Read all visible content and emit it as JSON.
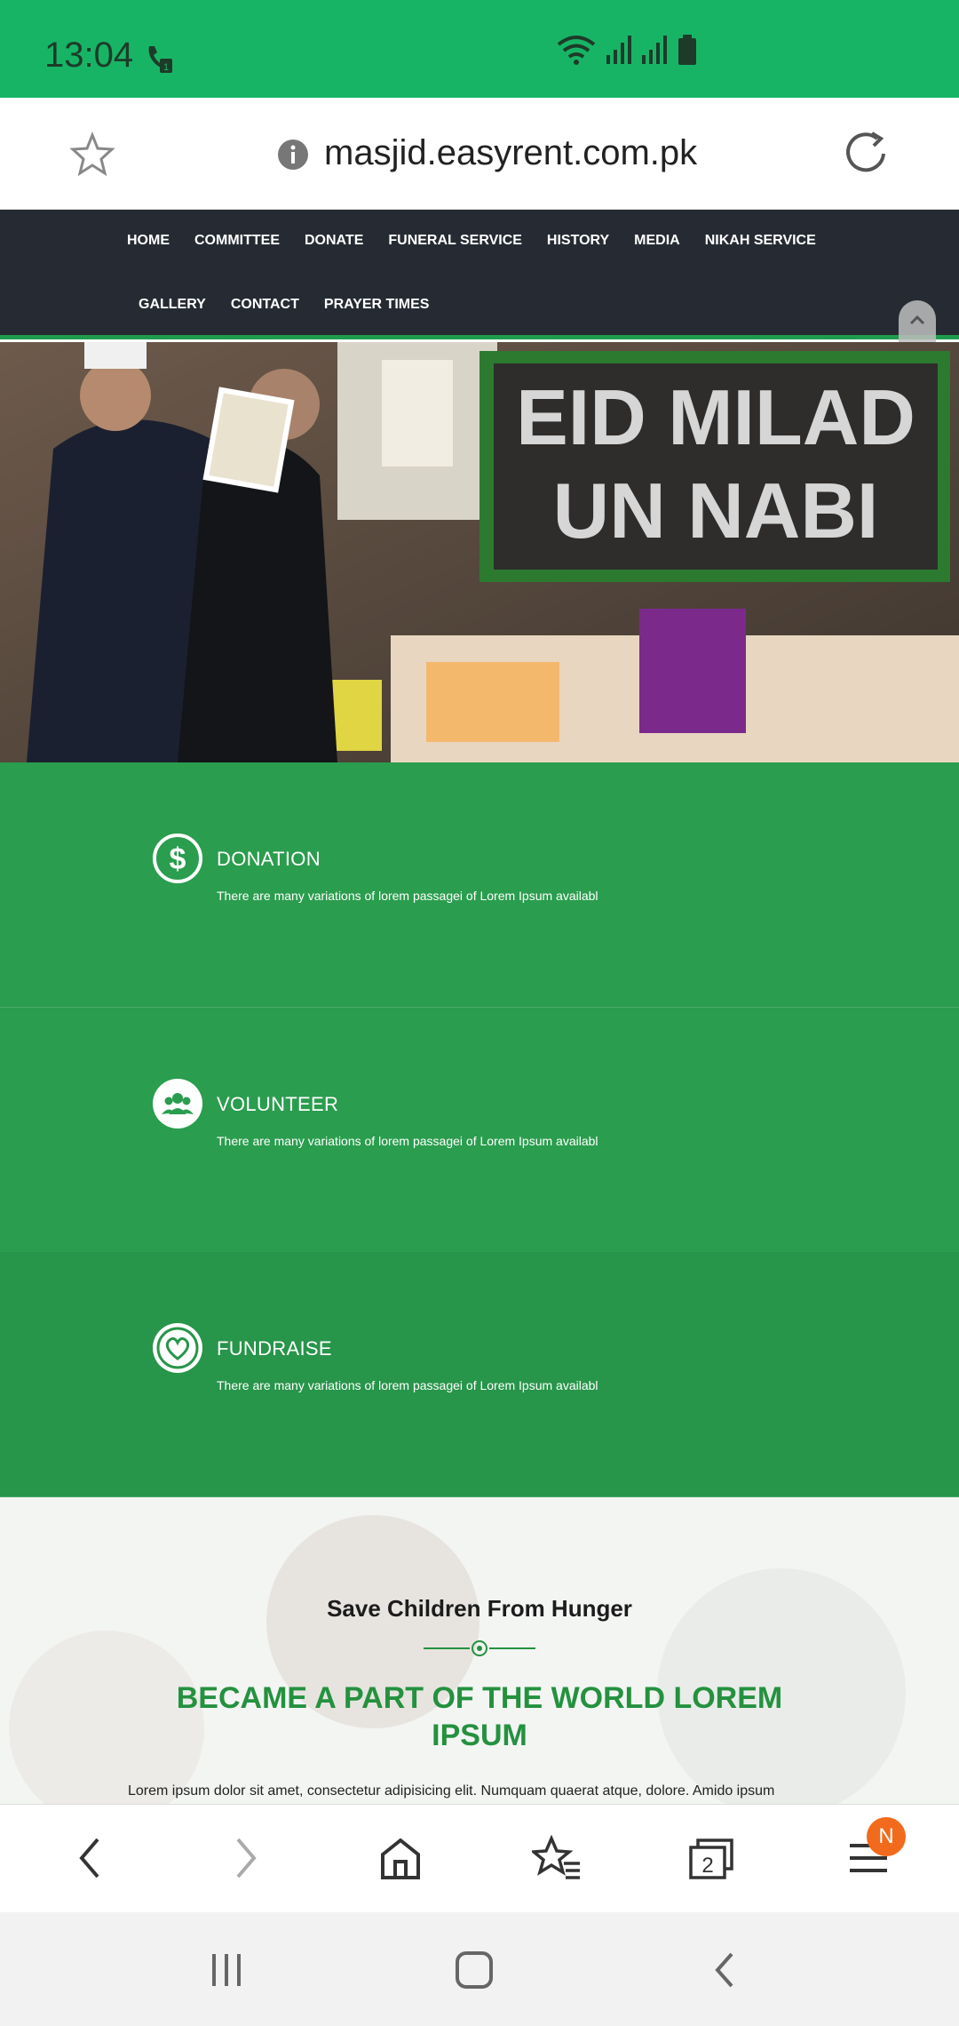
{
  "status_bar": {
    "time": "13:04",
    "icons": [
      "call-icon",
      "wifi-icon",
      "signal-icon",
      "signal-icon",
      "battery-icon"
    ],
    "color": "#18b466"
  },
  "browser": {
    "url": "masjid.easyrent.com.pk",
    "bookmark_icon": "star-icon",
    "info_icon": "info-icon",
    "reload_icon": "reload-icon"
  },
  "nav": {
    "row1": [
      "HOME",
      "COMMITTEE",
      "DONATE",
      "FUNERAL SERVICE",
      "HISTORY",
      "MEDIA",
      "NIKAH SERVICE"
    ],
    "row2": [
      "GALLERY",
      "CONTACT",
      "PRAYER TIMES"
    ]
  },
  "features": [
    {
      "title": "DONATION",
      "desc": "There are many variations of lorem passagei of Lorem Ipsum availabl",
      "icon": "dollar-icon"
    },
    {
      "title": "VOLUNTEER",
      "desc": "There are many variations of lorem passagei of Lorem Ipsum availabl",
      "icon": "users-icon"
    },
    {
      "title": "FUNDRAISE",
      "desc": "There are many variations of lorem passagei of Lorem Ipsum availabl",
      "icon": "heart-globe-icon"
    }
  ],
  "hero": {
    "banner_line1": "EID MILAD",
    "banner_line2": "UN NABI"
  },
  "save": {
    "title": "Save Children From Hunger",
    "heading": "BECAME A PART OF THE WORLD LOREM IPSUM",
    "body": "Lorem ipsum dolor sit amet, consectetur adipisicing elit. Numquam quaerat atque, dolore. Amido ipsum"
  },
  "bottom_bar": {
    "tabs_count": "2",
    "menu_badge": "N"
  },
  "colors": {
    "accent": "#2a9d4e",
    "nav_bg": "#262b33",
    "heading_green": "#24913f"
  }
}
